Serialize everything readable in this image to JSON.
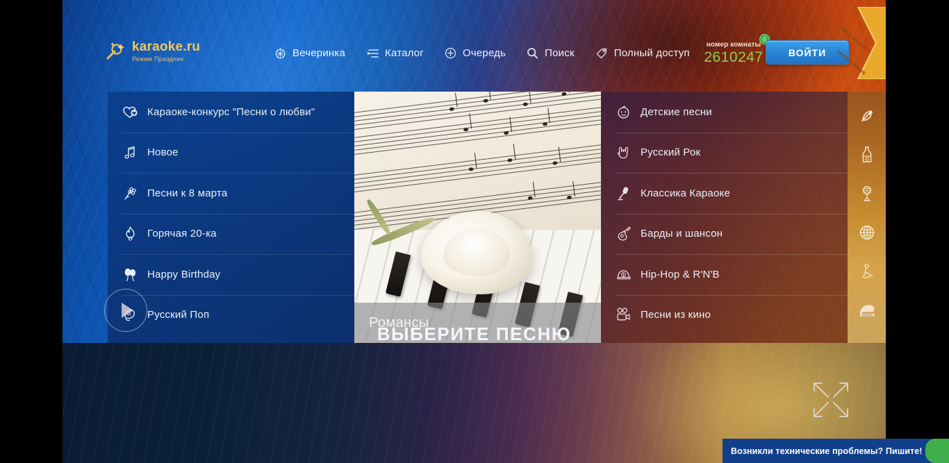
{
  "brand": {
    "name": "karaoke.ru",
    "tagline": "Режим Праздник",
    "logo_icon": "microphone-sparkle-icon"
  },
  "nav": {
    "items": [
      {
        "label": "Вечеринка",
        "icon": "disco-ball-icon"
      },
      {
        "label": "Каталог",
        "icon": "playlist-icon"
      },
      {
        "label": "Очередь",
        "icon": "plus-circle-icon"
      },
      {
        "label": "Поиск",
        "icon": "search-icon"
      },
      {
        "label": "Полный доступ",
        "icon": "tag-icon"
      }
    ]
  },
  "room": {
    "caption": "номер комнаты",
    "number": "2610247",
    "badge": "0"
  },
  "login_button": {
    "label": "ВОЙТИ"
  },
  "ribbon": {
    "line1": "СПЕЦИАЛЬНОЕ",
    "line2": "ПРЕДЛОЖЕНИЕ"
  },
  "menu_left": {
    "items": [
      {
        "label": "Караоке-конкурс \"Песни о любви\"",
        "icon": "heart-icon"
      },
      {
        "label": "Новое",
        "icon": "music-note-icon"
      },
      {
        "label": "Песни к 8 марта",
        "icon": "flower-bouquet-icon"
      },
      {
        "label": "Горячая 20-ка",
        "icon": "flame-icon"
      },
      {
        "label": "Happy Birthday",
        "icon": "balloons-icon"
      },
      {
        "label": "Русский Поп",
        "icon": "clapping-hands-icon"
      }
    ]
  },
  "menu_right": {
    "items": [
      {
        "label": "Детские песни",
        "icon": "baby-face-icon"
      },
      {
        "label": "Русский Рок",
        "icon": "rock-hand-icon"
      },
      {
        "label": "Классика Караоке",
        "icon": "microphone-icon"
      },
      {
        "label": "Барды и шансон",
        "icon": "guitar-icon"
      },
      {
        "label": "Hip-Hop & R'N'B",
        "icon": "cap-icon"
      },
      {
        "label": "Песни из кино",
        "icon": "movie-camera-icon"
      }
    ]
  },
  "center_card": {
    "caption": "Романсы",
    "artwork": "white-rose-on-piano-with-sheet-music"
  },
  "rail": {
    "items": [
      {
        "icon": "hammer-sickle-icon"
      },
      {
        "icon": "bottle-icon"
      },
      {
        "icon": "microphone-retro-icon"
      },
      {
        "icon": "globe-icon"
      },
      {
        "icon": "dancer-icon"
      },
      {
        "icon": "grand-piano-icon"
      }
    ]
  },
  "player": {
    "title": "ВЫБЕРИТЕ ПЕСНЮ",
    "play_icon": "play-icon",
    "fullscreen_icon": "fullscreen-expand-icon"
  },
  "toast": {
    "text": "Возникли технические проблемы? Пишите!"
  },
  "colors": {
    "accent_blue": "#2a86d6",
    "brand_gold": "#f2c85a",
    "room_green": "#8fd14f",
    "toast_blue": "#123f8a",
    "toast_green": "#3fae4b"
  }
}
